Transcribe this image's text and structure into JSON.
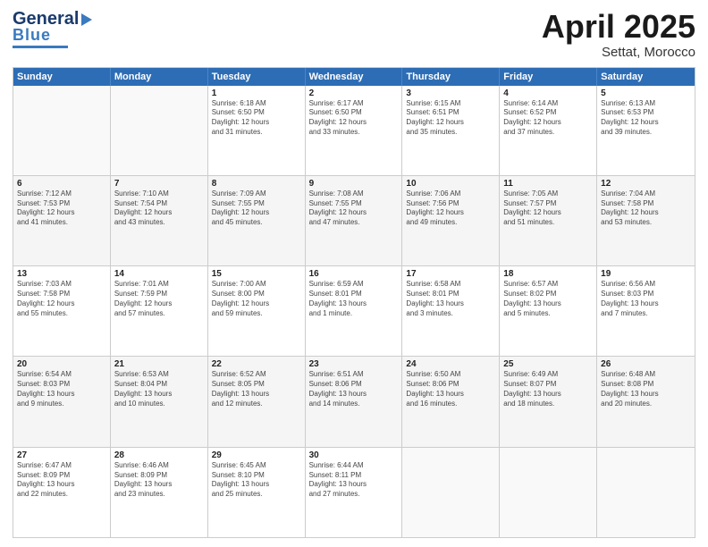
{
  "header": {
    "logo_general": "General",
    "logo_blue": "Blue",
    "main_title": "April 2025",
    "subtitle": "Settat, Morocco"
  },
  "days": [
    "Sunday",
    "Monday",
    "Tuesday",
    "Wednesday",
    "Thursday",
    "Friday",
    "Saturday"
  ],
  "weeks": [
    [
      {
        "day": "",
        "content": ""
      },
      {
        "day": "",
        "content": ""
      },
      {
        "day": "1",
        "content": "Sunrise: 6:18 AM\nSunset: 6:50 PM\nDaylight: 12 hours\nand 31 minutes."
      },
      {
        "day": "2",
        "content": "Sunrise: 6:17 AM\nSunset: 6:50 PM\nDaylight: 12 hours\nand 33 minutes."
      },
      {
        "day": "3",
        "content": "Sunrise: 6:15 AM\nSunset: 6:51 PM\nDaylight: 12 hours\nand 35 minutes."
      },
      {
        "day": "4",
        "content": "Sunrise: 6:14 AM\nSunset: 6:52 PM\nDaylight: 12 hours\nand 37 minutes."
      },
      {
        "day": "5",
        "content": "Sunrise: 6:13 AM\nSunset: 6:53 PM\nDaylight: 12 hours\nand 39 minutes."
      }
    ],
    [
      {
        "day": "6",
        "content": "Sunrise: 7:12 AM\nSunset: 7:53 PM\nDaylight: 12 hours\nand 41 minutes."
      },
      {
        "day": "7",
        "content": "Sunrise: 7:10 AM\nSunset: 7:54 PM\nDaylight: 12 hours\nand 43 minutes."
      },
      {
        "day": "8",
        "content": "Sunrise: 7:09 AM\nSunset: 7:55 PM\nDaylight: 12 hours\nand 45 minutes."
      },
      {
        "day": "9",
        "content": "Sunrise: 7:08 AM\nSunset: 7:55 PM\nDaylight: 12 hours\nand 47 minutes."
      },
      {
        "day": "10",
        "content": "Sunrise: 7:06 AM\nSunset: 7:56 PM\nDaylight: 12 hours\nand 49 minutes."
      },
      {
        "day": "11",
        "content": "Sunrise: 7:05 AM\nSunset: 7:57 PM\nDaylight: 12 hours\nand 51 minutes."
      },
      {
        "day": "12",
        "content": "Sunrise: 7:04 AM\nSunset: 7:58 PM\nDaylight: 12 hours\nand 53 minutes."
      }
    ],
    [
      {
        "day": "13",
        "content": "Sunrise: 7:03 AM\nSunset: 7:58 PM\nDaylight: 12 hours\nand 55 minutes."
      },
      {
        "day": "14",
        "content": "Sunrise: 7:01 AM\nSunset: 7:59 PM\nDaylight: 12 hours\nand 57 minutes."
      },
      {
        "day": "15",
        "content": "Sunrise: 7:00 AM\nSunset: 8:00 PM\nDaylight: 12 hours\nand 59 minutes."
      },
      {
        "day": "16",
        "content": "Sunrise: 6:59 AM\nSunset: 8:01 PM\nDaylight: 13 hours\nand 1 minute."
      },
      {
        "day": "17",
        "content": "Sunrise: 6:58 AM\nSunset: 8:01 PM\nDaylight: 13 hours\nand 3 minutes."
      },
      {
        "day": "18",
        "content": "Sunrise: 6:57 AM\nSunset: 8:02 PM\nDaylight: 13 hours\nand 5 minutes."
      },
      {
        "day": "19",
        "content": "Sunrise: 6:56 AM\nSunset: 8:03 PM\nDaylight: 13 hours\nand 7 minutes."
      }
    ],
    [
      {
        "day": "20",
        "content": "Sunrise: 6:54 AM\nSunset: 8:03 PM\nDaylight: 13 hours\nand 9 minutes."
      },
      {
        "day": "21",
        "content": "Sunrise: 6:53 AM\nSunset: 8:04 PM\nDaylight: 13 hours\nand 10 minutes."
      },
      {
        "day": "22",
        "content": "Sunrise: 6:52 AM\nSunset: 8:05 PM\nDaylight: 13 hours\nand 12 minutes."
      },
      {
        "day": "23",
        "content": "Sunrise: 6:51 AM\nSunset: 8:06 PM\nDaylight: 13 hours\nand 14 minutes."
      },
      {
        "day": "24",
        "content": "Sunrise: 6:50 AM\nSunset: 8:06 PM\nDaylight: 13 hours\nand 16 minutes."
      },
      {
        "day": "25",
        "content": "Sunrise: 6:49 AM\nSunset: 8:07 PM\nDaylight: 13 hours\nand 18 minutes."
      },
      {
        "day": "26",
        "content": "Sunrise: 6:48 AM\nSunset: 8:08 PM\nDaylight: 13 hours\nand 20 minutes."
      }
    ],
    [
      {
        "day": "27",
        "content": "Sunrise: 6:47 AM\nSunset: 8:09 PM\nDaylight: 13 hours\nand 22 minutes."
      },
      {
        "day": "28",
        "content": "Sunrise: 6:46 AM\nSunset: 8:09 PM\nDaylight: 13 hours\nand 23 minutes."
      },
      {
        "day": "29",
        "content": "Sunrise: 6:45 AM\nSunset: 8:10 PM\nDaylight: 13 hours\nand 25 minutes."
      },
      {
        "day": "30",
        "content": "Sunrise: 6:44 AM\nSunset: 8:11 PM\nDaylight: 13 hours\nand 27 minutes."
      },
      {
        "day": "",
        "content": ""
      },
      {
        "day": "",
        "content": ""
      },
      {
        "day": "",
        "content": ""
      }
    ]
  ]
}
